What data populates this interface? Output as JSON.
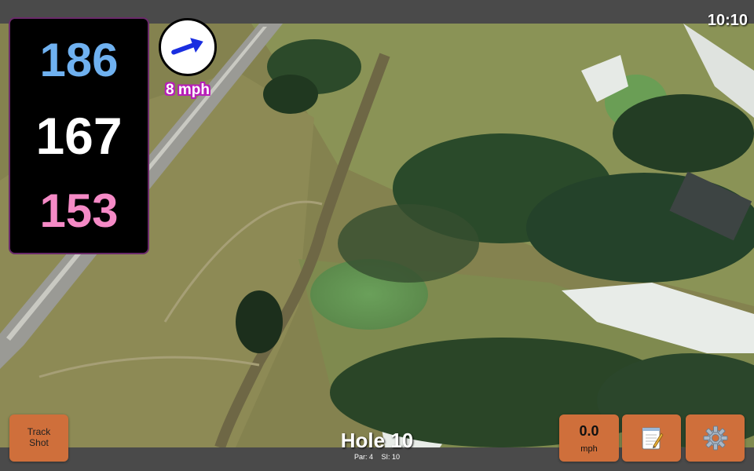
{
  "status": {
    "clock": "10:10"
  },
  "distances": {
    "back": "186",
    "middle": "167",
    "front": "153"
  },
  "wind": {
    "speed_label": "8 mph",
    "arrow_icon": "wind-arrow-icon",
    "arrow_color": "#1a2ee0"
  },
  "hole": {
    "title": "Hole 10",
    "par_label": "Par: 4",
    "si_label": "SI: 10"
  },
  "buttons": {
    "track_shot_line1": "Track",
    "track_shot_line2": "Shot",
    "speed_value": "0.0",
    "speed_unit": "mph",
    "notes_icon": "notepad-icon",
    "settings_icon": "gear-icon"
  },
  "colors": {
    "button": "#cf6f3b",
    "back_distance": "#6fb1f0",
    "front_distance": "#f58ac6",
    "wind_outline": "#b81eb8"
  }
}
